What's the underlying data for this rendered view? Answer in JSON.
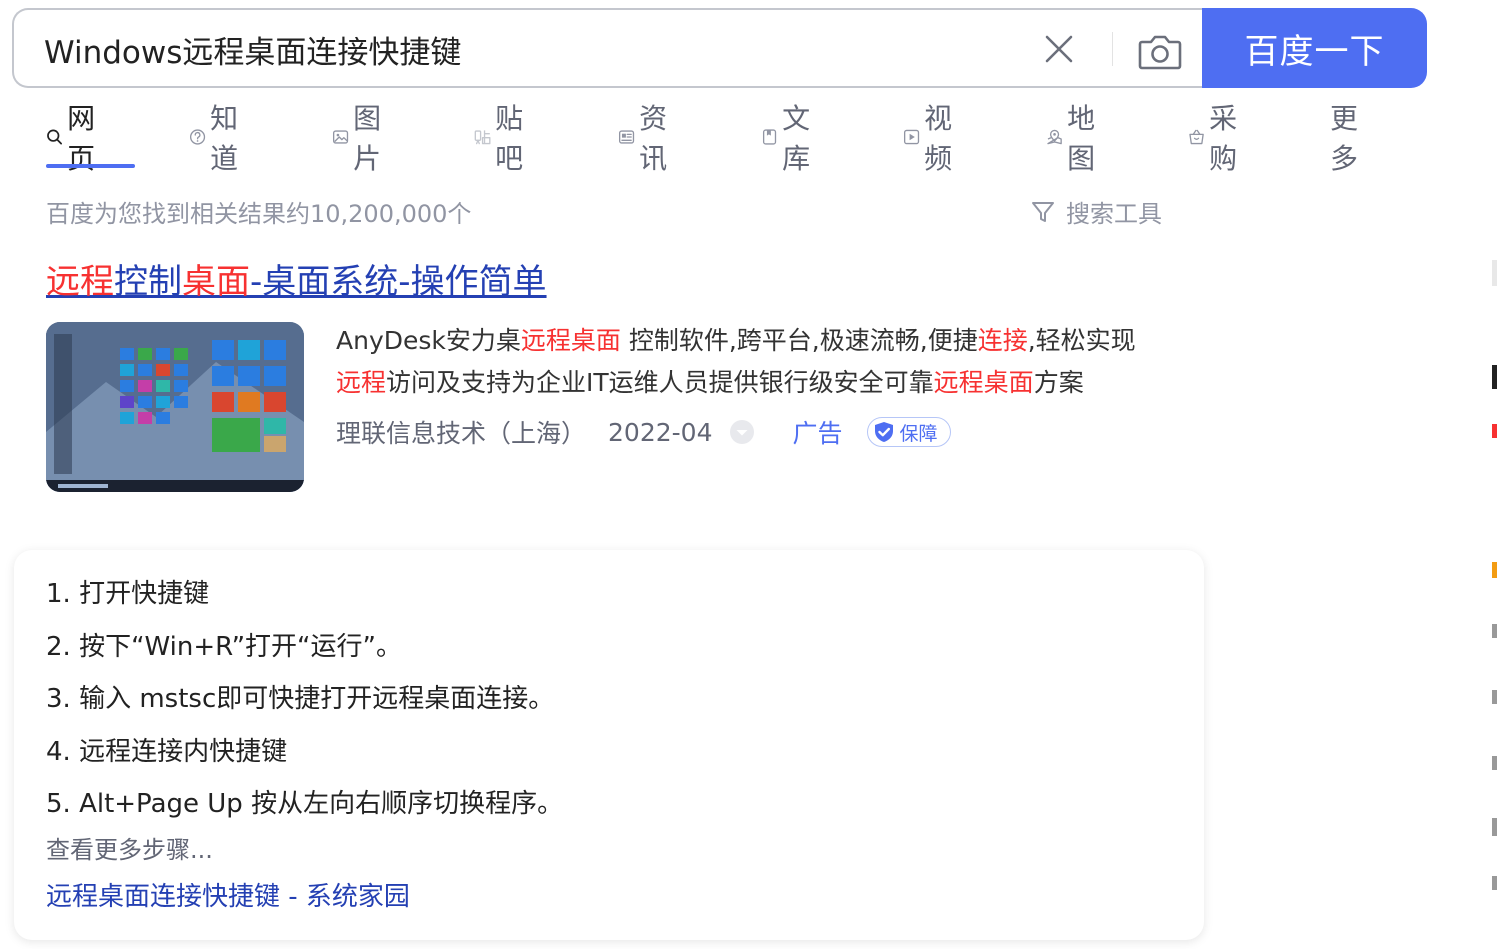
{
  "search": {
    "query": "Windows远程桌面连接快捷键",
    "button_label": "百度一下"
  },
  "tabs": [
    {
      "label": "网页",
      "icon": "search-icon"
    },
    {
      "label": "知道",
      "icon": "question-icon"
    },
    {
      "label": "图片",
      "icon": "image-icon"
    },
    {
      "label": "贴吧",
      "icon": "tieba-icon"
    },
    {
      "label": "资讯",
      "icon": "news-icon"
    },
    {
      "label": "文库",
      "icon": "document-icon"
    },
    {
      "label": "视频",
      "icon": "play-icon"
    },
    {
      "label": "地图",
      "icon": "map-icon"
    },
    {
      "label": "采购",
      "icon": "basket-icon"
    },
    {
      "label": "更多",
      "icon": ""
    }
  ],
  "results_meta": {
    "count_text": "百度为您找到相关结果约10,200,000个",
    "tools_label": "搜索工具"
  },
  "ad_result": {
    "title_parts": [
      {
        "text": "远程",
        "hl": true
      },
      {
        "text": "控制",
        "hl": false
      },
      {
        "text": "桌面",
        "hl": true
      },
      {
        "text": "-桌面系统-操作简单",
        "hl": false
      }
    ],
    "desc_parts": [
      {
        "text": "AnyDesk安力桌",
        "hl": false
      },
      {
        "text": "远程桌面",
        "hl": true
      },
      {
        "text": " 控制软件,跨平台,极速流畅,便捷",
        "hl": false
      },
      {
        "text": "连接",
        "hl": true
      },
      {
        "text": ",轻松实现",
        "hl": false
      },
      {
        "text": "远程",
        "hl": true
      },
      {
        "text": "访问及支持为企业IT运维人员提供银行级安全可靠",
        "hl": false
      },
      {
        "text": "远程桌面",
        "hl": true
      },
      {
        "text": "方案",
        "hl": false
      }
    ],
    "source": "理联信息技术（上海）",
    "date": "2022-04",
    "ad_label": "广告",
    "badge_label": "保障"
  },
  "steps_card": {
    "steps": [
      "1. 打开快捷键",
      "2. 按下“Win+R”打开“运行”。",
      "3. 输入 mstsc即可快捷打开远程桌面连接。",
      "4. 远程连接内快捷键",
      "5. Alt+Page Up 按从左向右顺序切换程序。"
    ],
    "more_label": "查看更多步骤...",
    "link_text": "远程桌面连接快捷键 - 系统家园"
  },
  "colors": {
    "brand_blue": "#4e6ef2",
    "link_blue": "#2440b3",
    "highlight_red": "#f73131",
    "muted_gray": "#9195a3"
  }
}
